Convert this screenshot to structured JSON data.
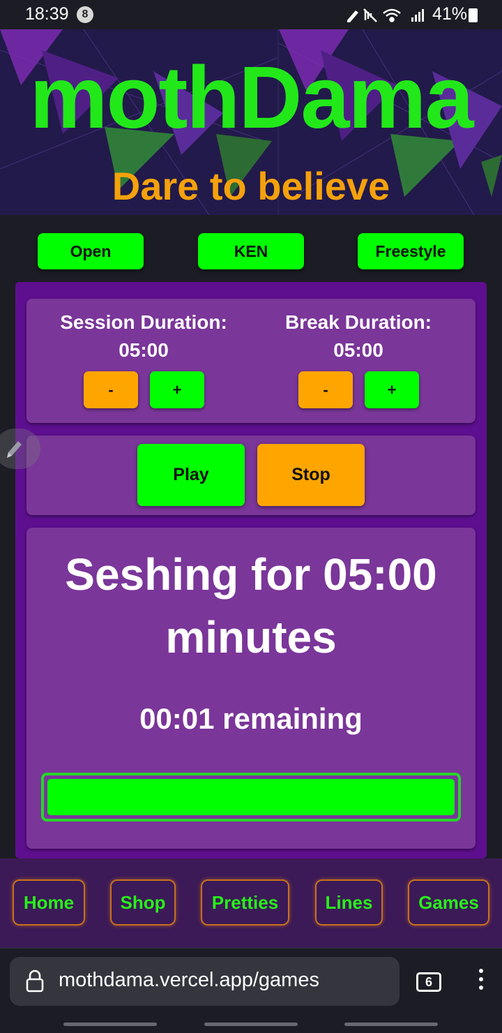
{
  "status_bar": {
    "time": "18:39",
    "notification_count": "8",
    "icons": [
      "edit-icon",
      "mute-icon",
      "wifi-icon",
      "signal-icon"
    ],
    "battery_percent": "41%"
  },
  "banner": {
    "title": "mothDama",
    "subtitle": "Dare to believe",
    "title_color": "#22e81a",
    "subtitle_color": "#f4a10c"
  },
  "modes": [
    {
      "label": "Open"
    },
    {
      "label": "KEN"
    },
    {
      "label": "Freestyle"
    }
  ],
  "session": {
    "label": "Session Duration:",
    "value": "05:00",
    "decrement_label": "-",
    "increment_label": "+"
  },
  "break": {
    "label": "Break Duration:",
    "value": "05:00",
    "decrement_label": "-",
    "increment_label": "+"
  },
  "controls": {
    "play_label": "Play",
    "stop_label": "Stop"
  },
  "timer": {
    "title": "Seshing for 05:00 minutes",
    "remaining": "00:01 remaining",
    "progress_fraction": 1.0
  },
  "nav": {
    "items": [
      {
        "label": "Home"
      },
      {
        "label": "Shop"
      },
      {
        "label": "Pretties"
      },
      {
        "label": "Lines"
      },
      {
        "label": "Games"
      }
    ]
  },
  "browser": {
    "url": "mothdama.vercel.app/games",
    "tab_count": "6"
  },
  "colors": {
    "accent_green": "#00ff00",
    "accent_orange": "#ffa500",
    "panel_purple": "#7a3699",
    "outer_purple": "#5e0f8f",
    "nav_purple": "#3c1a57"
  }
}
